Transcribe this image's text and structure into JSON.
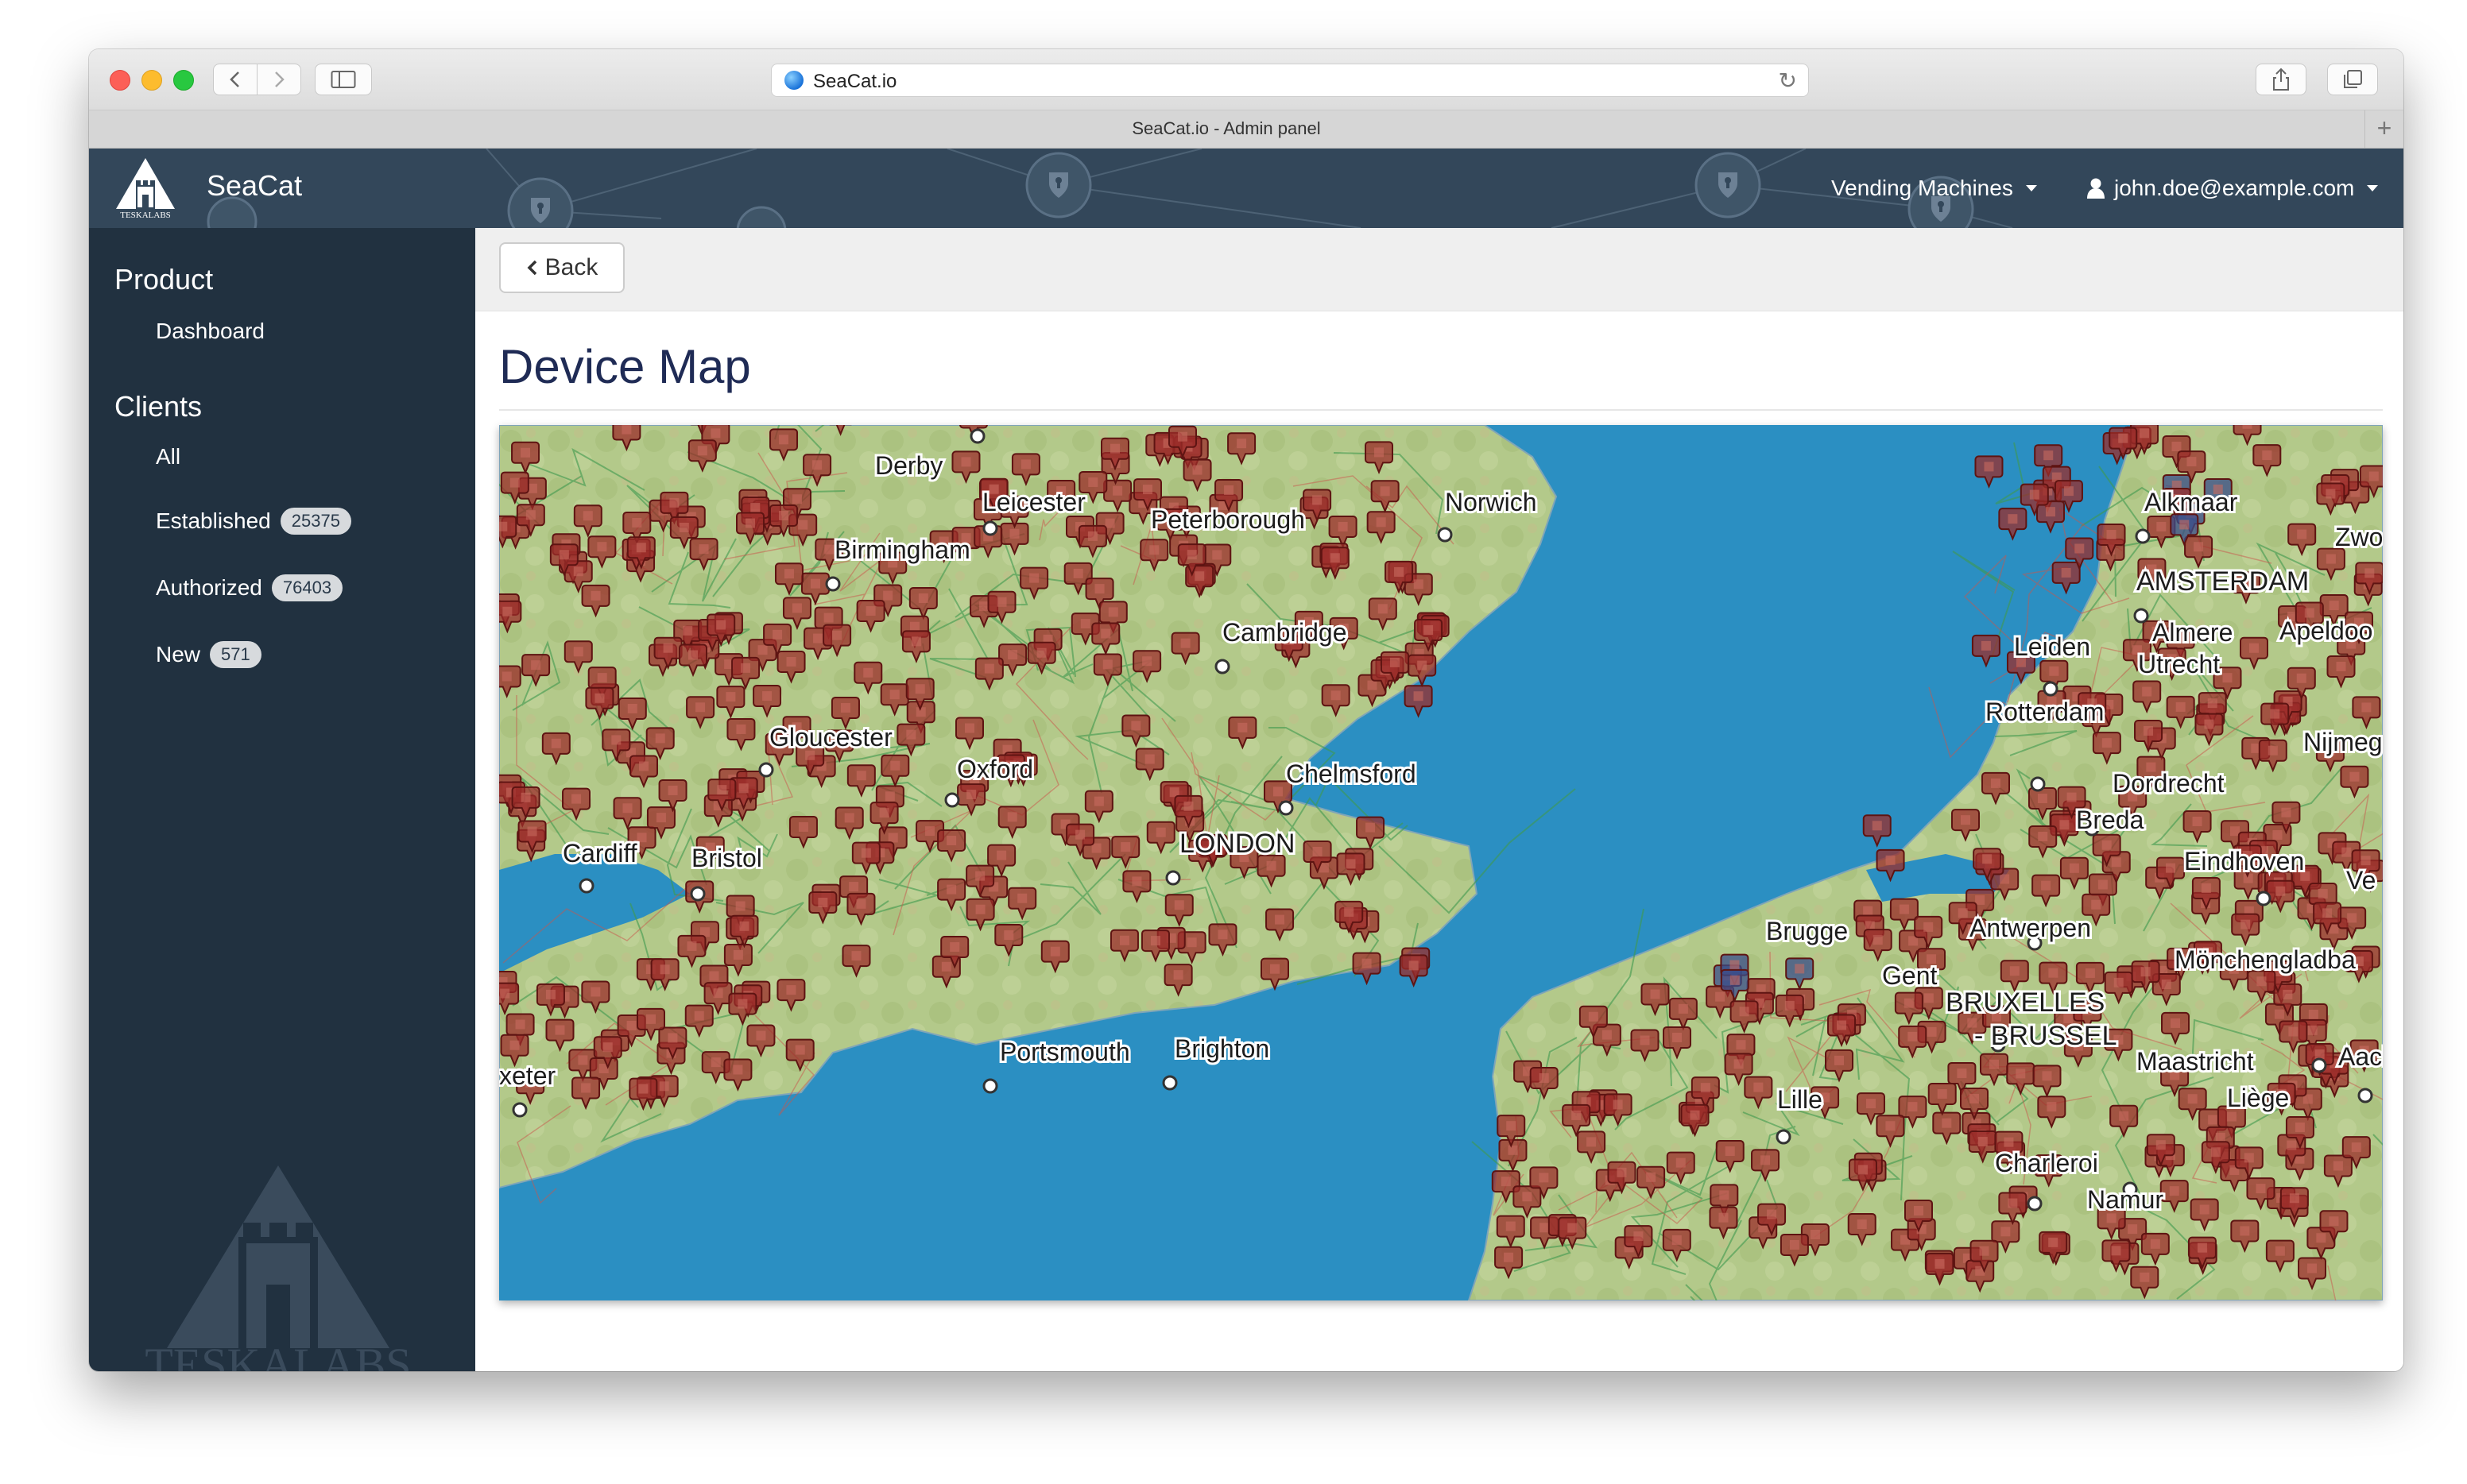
{
  "browser": {
    "url": "SeaCat.io",
    "tab_title": "SeaCat.io - Admin panel",
    "new_tab": "+"
  },
  "header": {
    "logo_text": "TESKALABS",
    "brand": "SeaCat",
    "menu_vending": "Vending Machines",
    "menu_user": "john.doe@example.com"
  },
  "sidebar": {
    "sections": [
      {
        "title": "Product",
        "items": [
          {
            "label": "Dashboard"
          }
        ]
      },
      {
        "title": "Clients",
        "items": [
          {
            "label": "All"
          },
          {
            "label": "Established",
            "badge": "25375"
          },
          {
            "label": "Authorized",
            "badge": "76403"
          },
          {
            "label": "New",
            "badge": "571"
          }
        ]
      }
    ],
    "watermark_text": "TESKALABS"
  },
  "main": {
    "back_label": "Back",
    "page_title": "Device Map"
  },
  "map": {
    "colors": {
      "sea": "#2a90c3",
      "land": "#b6cb8a",
      "marker": "#9b2c2a",
      "marker_blue": "#3a4c8a"
    },
    "labels": [
      "Derby",
      "Leicester",
      "Peterborough",
      "Norwich",
      "Birmingham",
      "Cambridge",
      "Gloucester",
      "Oxford",
      "Chelmsford",
      "LONDON",
      "Cardiff",
      "Bristol",
      "Portsmouth",
      "Brighton",
      "xeter",
      "Alkmaar",
      "AMSTERDAM",
      "Zwo",
      "Leiden",
      "Almere",
      "Apeldoo",
      "Utrecht",
      "Rotterdam",
      "Nijmegen",
      "Dordrecht",
      "Breda",
      "Eindhoven",
      "Ve",
      "Brugge",
      "Antwerpen",
      "Gent",
      "BRUXELLES",
      "- BRUSSEL",
      "Mönchengladba",
      "Maastricht",
      "Aach",
      "Lille",
      "Liège",
      "Charleroi",
      "Namur"
    ]
  }
}
